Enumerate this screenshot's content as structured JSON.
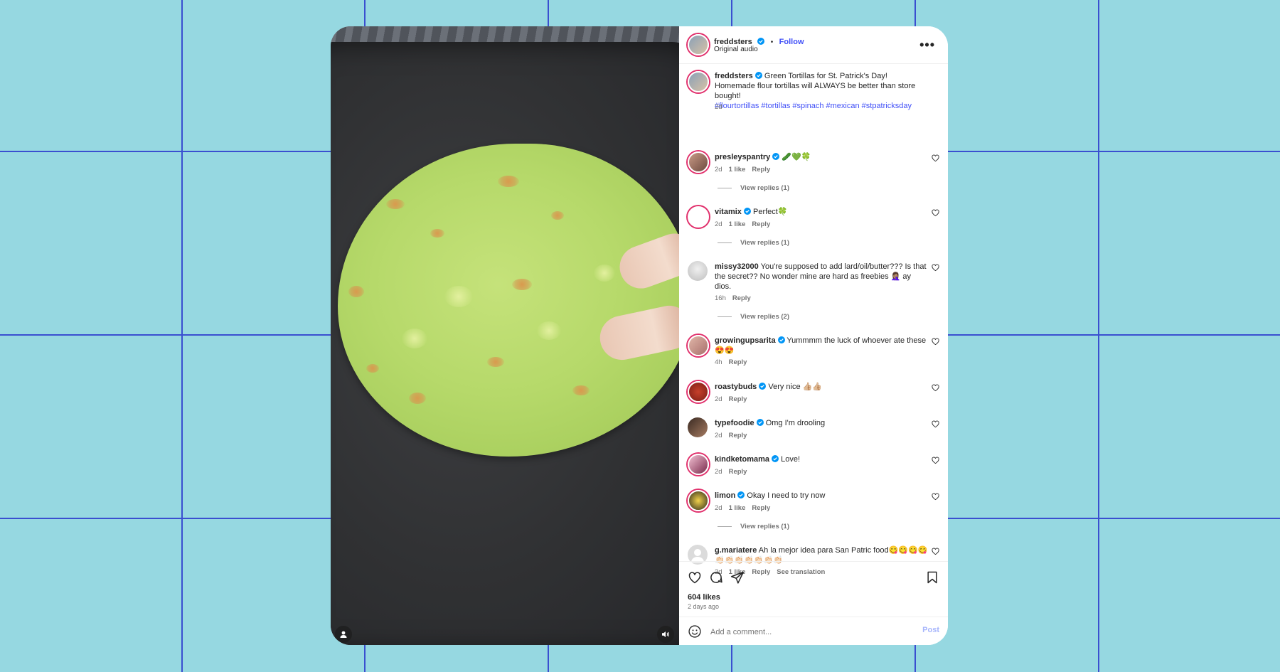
{
  "post": {
    "author": "freddsters",
    "follow_label": "Follow",
    "dot": "•",
    "audio": "Original audio",
    "more_label": "•••",
    "caption_author": "freddsters",
    "caption_text": "Green Tortillas for St. Patrick's Day! Homemade flour tortillas will ALWAYS be better than store bought!",
    "hashtags": "#flourtortillas #tortillas #spinach #mexican #stpatricksday",
    "caption_time": "2d"
  },
  "comments": [
    {
      "user": "presleyspantry",
      "text": "🥒💚🍀",
      "time": "2d",
      "likes": "1 like",
      "reply": "Reply",
      "view_replies": "View replies (1)"
    },
    {
      "user": "vitamix",
      "text": "Perfect🍀",
      "time": "2d",
      "likes": "1 like",
      "reply": "Reply",
      "view_replies": "View replies (1)"
    },
    {
      "user": "missy32000",
      "text": "You're supposed to add lard/oil/butter??? Is that the secret?? No wonder mine are hard as freebies 🤦🏽‍♀️ ay dios.",
      "time": "16h",
      "reply": "Reply",
      "view_replies": "View replies (2)"
    },
    {
      "user": "growingupsarita",
      "text": "Yummmm the luck of whoever ate these 😍😍",
      "time": "4h",
      "reply": "Reply"
    },
    {
      "user": "roastybuds",
      "text": "Very nice 👍🏼👍🏼",
      "time": "2d",
      "reply": "Reply"
    },
    {
      "user": "typefoodie",
      "text": "Omg I'm drooling",
      "time": "2d",
      "reply": "Reply"
    },
    {
      "user": "kindketomama",
      "text": "Love!",
      "time": "2d",
      "reply": "Reply"
    },
    {
      "user": "limon",
      "text": "Okay I need to try now",
      "time": "2d",
      "likes": "1 like",
      "reply": "Reply",
      "view_replies": "View replies (1)"
    },
    {
      "user": "g.mariatere",
      "text": "Ah la mejor idea para San Patric food😋😋😋😋👏🏻👏🏻👏🏻👏🏻👏🏻👏🏻👏🏻",
      "time": "2d",
      "likes": "1 like",
      "reply": "Reply",
      "see_translation": "See translation"
    }
  ],
  "footer": {
    "likes": "604 likes",
    "time": "2 days ago",
    "comment_placeholder": "Add a comment...",
    "post_label": "Post"
  },
  "colors": {
    "accent": "#4150f7",
    "background": "#96d8e1",
    "grid": "#3a4fd0"
  },
  "icons": [
    "user-icon",
    "volume-icon",
    "heart-icon",
    "comment-icon",
    "share-icon",
    "bookmark-icon",
    "emoji-icon",
    "verified-icon",
    "more-icon"
  ]
}
